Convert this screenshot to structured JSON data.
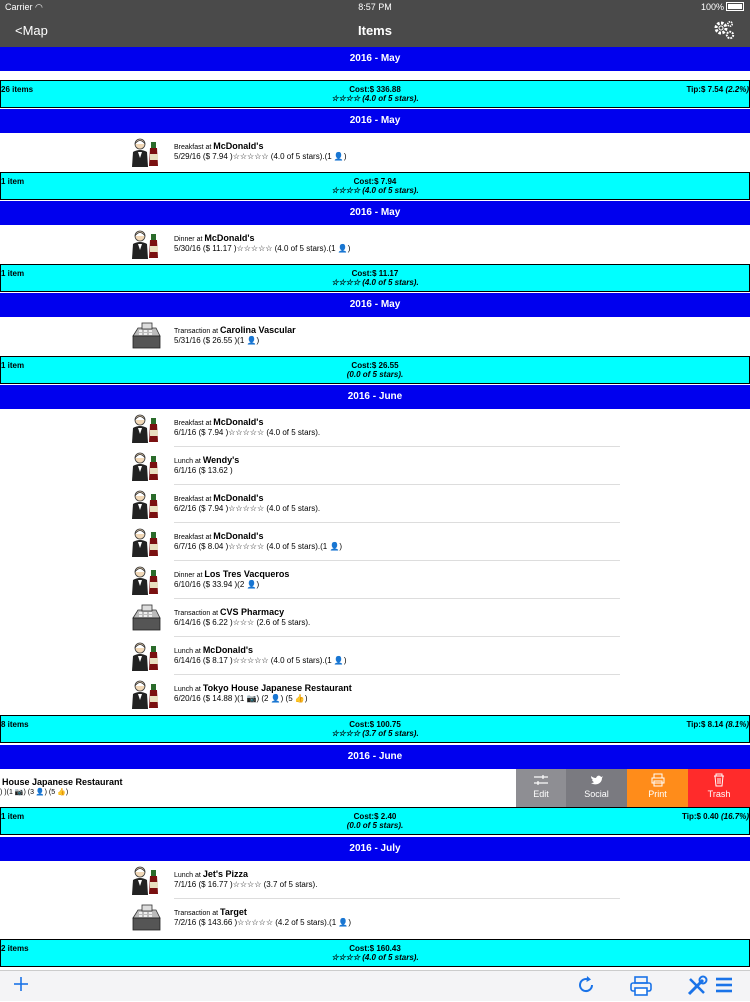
{
  "status": {
    "carrier": "Carrier",
    "time": "8:57 PM",
    "battery": "100%"
  },
  "nav": {
    "back": "<Map",
    "title": "Items"
  },
  "months": {
    "m1": "2016 - May",
    "m2": "2016 - May",
    "m3": "2016 - May",
    "m4": "2016 - May",
    "m5": "2016 - June",
    "m6": "2016 - June",
    "m7": "2016 - July"
  },
  "summaries": {
    "s1": {
      "count": "26 items",
      "cost": "Cost:$ 336.88",
      "stars": "☆☆☆☆ (4.0 of 5 stars).",
      "tip": "Tip:$ 7.54",
      "tip_pct": "(2.2%)"
    },
    "s2": {
      "count": "1 item",
      "cost": "Cost:$ 7.94",
      "stars": "☆☆☆☆ (4.0 of 5 stars)."
    },
    "s3": {
      "count": "1 item",
      "cost": "Cost:$ 11.17",
      "stars": "☆☆☆☆ (4.0 of 5 stars)."
    },
    "s4": {
      "count": "1 item",
      "cost": "Cost:$ 26.55",
      "stars": "(0.0 of 5 stars)."
    },
    "s5": {
      "count": "8 items",
      "cost": "Cost:$ 100.75",
      "stars": "☆☆☆☆ (3.7 of 5 stars).",
      "tip": "Tip:$ 8.14",
      "tip_pct": "(8.1%)"
    },
    "s6": {
      "count": "1 item",
      "cost": "Cost:$ 2.40",
      "stars": "(0.0 of 5 stars).",
      "tip": "Tip:$ 0.40",
      "tip_pct": "(16.7%)"
    },
    "s7": {
      "count": "2 items",
      "cost": "Cost:$ 160.43",
      "stars": "☆☆☆☆ (4.0 of 5 stars)."
    }
  },
  "items": {
    "i1": {
      "type": "Breakfast at ",
      "place": "McDonald's",
      "detail": "5/29/16 ($ 7.94 )☆☆☆☆☆ (4.0 of 5 stars).(1 👤)",
      "icon": "meal-icon"
    },
    "i2": {
      "type": "Dinner at ",
      "place": "McDonald's",
      "detail": "5/30/16 ($ 11.17 )☆☆☆☆☆ (4.0 of 5 stars).(1 👤)",
      "icon": "meal-icon"
    },
    "i3": {
      "type": "Transaction at ",
      "place": "Carolina Vascular",
      "detail": "5/31/16 ($ 26.55 )(1 👤)",
      "icon": "register-icon"
    },
    "i4": {
      "type": "Breakfast at ",
      "place": "McDonald's",
      "detail": "6/1/16 ($ 7.94 )☆☆☆☆☆ (4.0 of 5 stars).",
      "icon": "meal-icon"
    },
    "i5": {
      "type": "Lunch at ",
      "place": "Wendy's",
      "detail": "6/1/16 ($ 13.62 )",
      "icon": "meal-icon"
    },
    "i6": {
      "type": "Breakfast at ",
      "place": "McDonald's",
      "detail": "6/2/16 ($ 7.94 )☆☆☆☆☆ (4.0 of 5 stars).",
      "icon": "meal-icon"
    },
    "i7": {
      "type": "Breakfast at ",
      "place": "McDonald's",
      "detail": "6/7/16 ($ 8.04 )☆☆☆☆☆ (4.0 of 5 stars).(1 👤)",
      "icon": "meal-icon"
    },
    "i8": {
      "type": "Dinner at ",
      "place": "Los Tres Vacqueros",
      "detail": "6/10/16 ($ 33.94 )(2 👤)",
      "icon": "meal-icon"
    },
    "i9": {
      "type": "Transaction at ",
      "place": "CVS Pharmacy",
      "detail": "6/14/16 ($ 6.22 )☆☆☆ (2.6 of 5 stars).",
      "icon": "register-icon"
    },
    "i10": {
      "type": "Lunch at ",
      "place": "McDonald's",
      "detail": "6/14/16 ($ 8.17 )☆☆☆☆☆ (4.0 of 5 stars).(1 👤)",
      "icon": "meal-icon"
    },
    "i11": {
      "type": "Lunch at ",
      "place": "Tokyo House Japanese Restaurant",
      "detail": "6/20/16 ($ 14.88 )(1 📷) (2 👤) (5 👍)",
      "icon": "meal-icon"
    },
    "i12": {
      "type": "Lunch at ",
      "place": "Jet's Pizza",
      "detail": "7/1/16 ($ 16.77 )☆☆☆☆ (3.7 of 5 stars).",
      "icon": "meal-icon"
    },
    "i13": {
      "type": "Transaction at ",
      "place": "Target",
      "detail": "7/2/16 ($ 143.66 )☆☆☆☆☆ (4.2 of 5 stars).(1 👤)",
      "icon": "register-icon"
    }
  },
  "swiped": {
    "title": "House Japanese Restaurant",
    "detail": ") )(1 📷) (3 👤) (5 👍)"
  },
  "actions": {
    "edit": "Edit",
    "social": "Social",
    "print": "Print",
    "trash": "Trash"
  },
  "colors": {
    "month_bar": "#0000ee",
    "summary_bg": "#00ffff",
    "edit": "#8e8e93",
    "social": "#7a7a80",
    "print": "#ff8c1a",
    "trash": "#ff2b2b"
  }
}
